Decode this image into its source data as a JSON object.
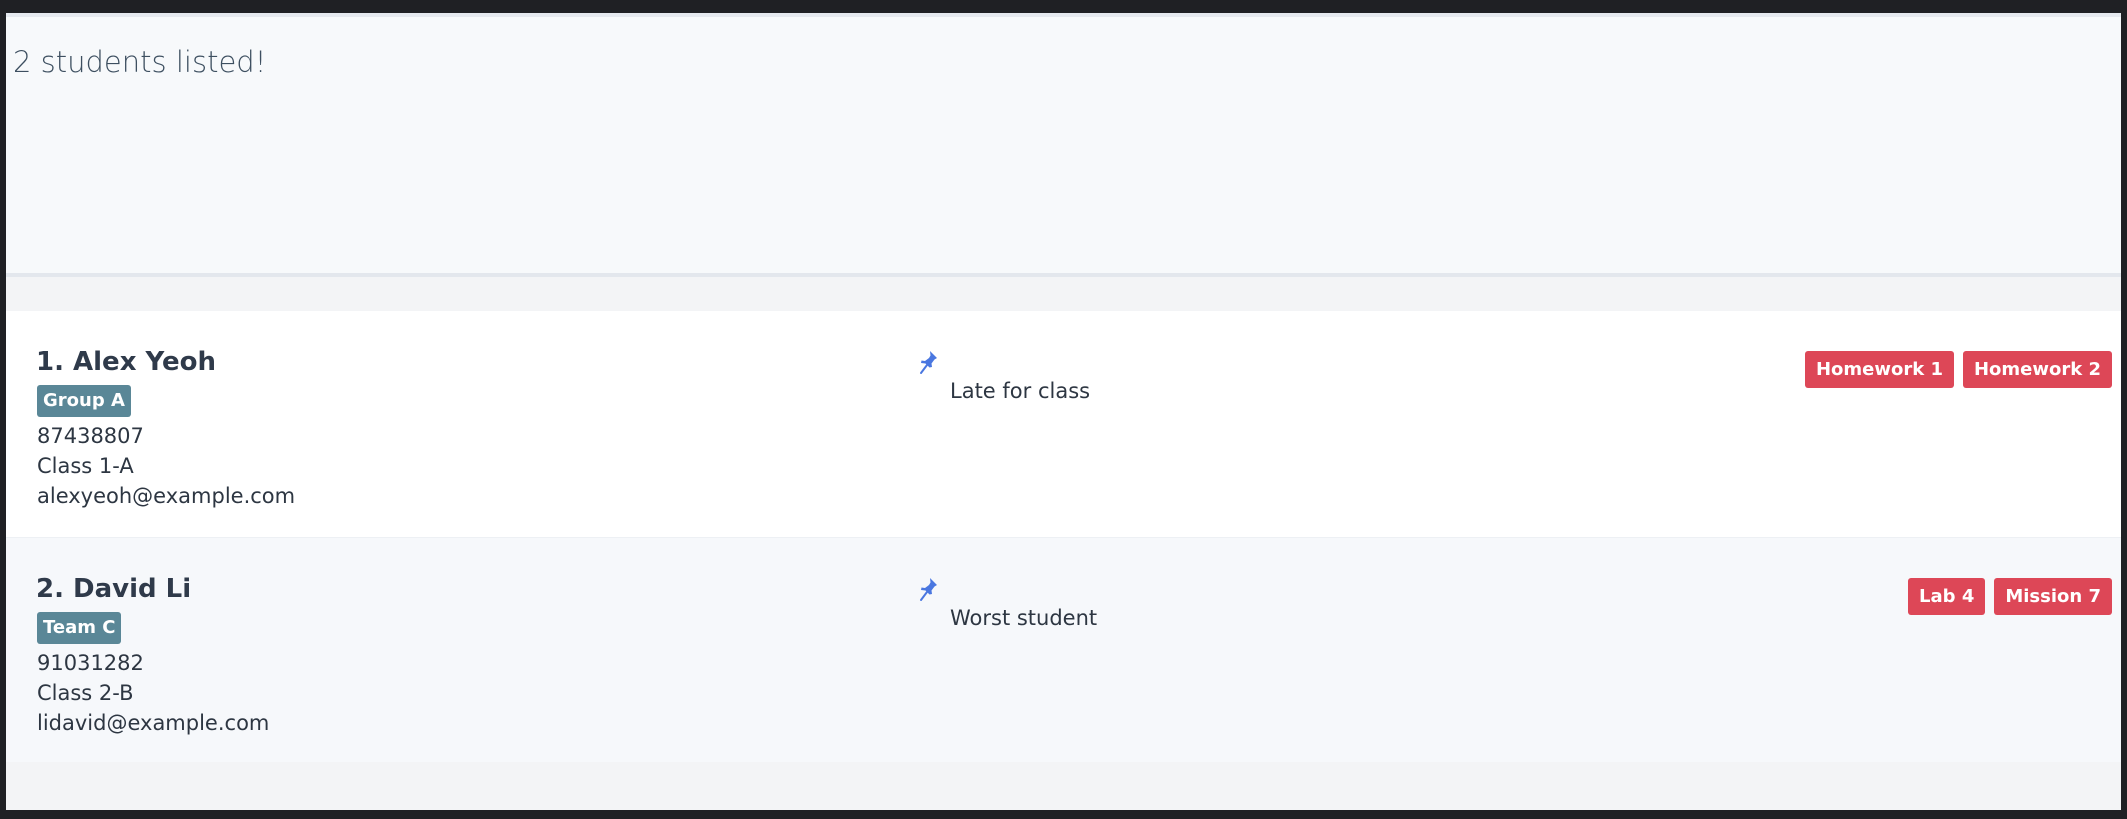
{
  "result": {
    "message": "2 students listed!"
  },
  "students": [
    {
      "name": "1. Alex Yeoh",
      "group": "Group A",
      "phone": "87438807",
      "class": "Class 1-A",
      "email": "alexyeoh@example.com",
      "remark_icon": "pin-icon",
      "remark": "Late for class",
      "assignments": [
        "Homework 1",
        "Homework 2"
      ]
    },
    {
      "name": "2. David Li",
      "group": "Team C",
      "phone": "91031282",
      "class": "Class 2-B",
      "email": "lidavid@example.com",
      "remark_icon": "pin-icon",
      "remark": "Worst student",
      "assignments": [
        "Lab 4",
        "Mission 7"
      ]
    }
  ],
  "colors": {
    "group_tag": "#5a8797",
    "assignment_tag": "#dd4757",
    "pin": "#4a77e0"
  }
}
